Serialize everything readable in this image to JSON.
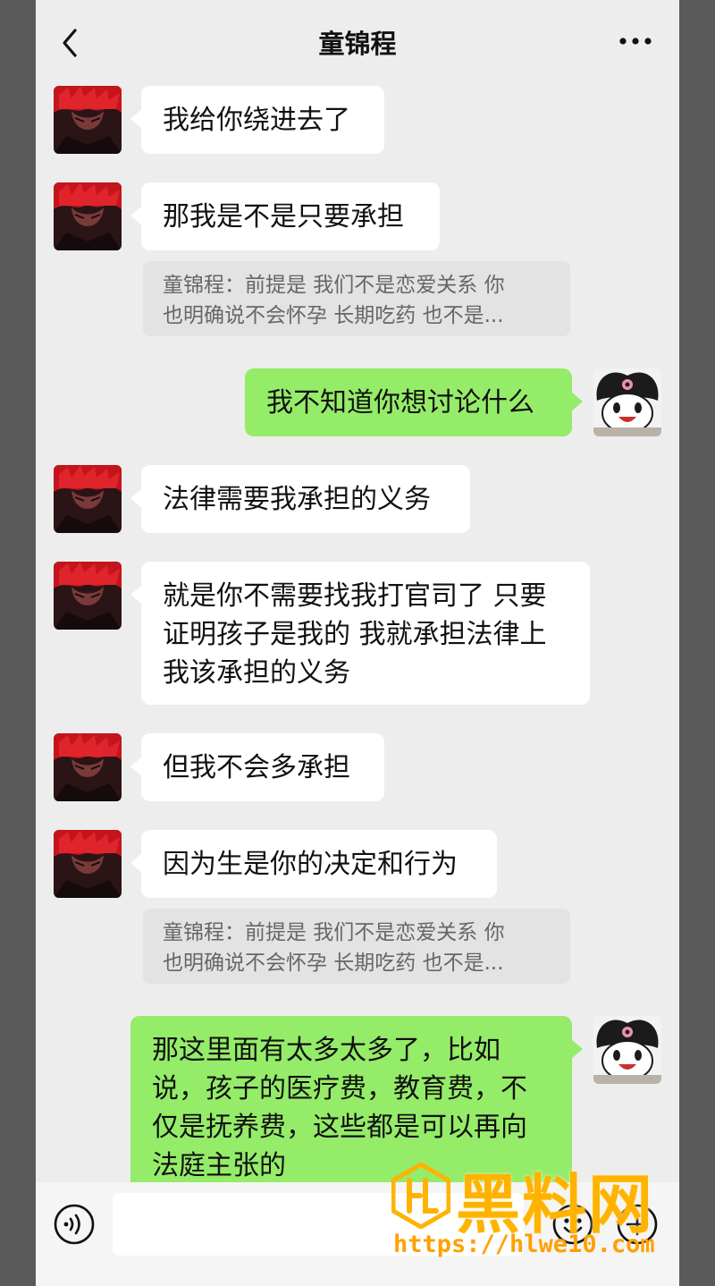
{
  "header": {
    "title": "童锦程"
  },
  "messages": [
    {
      "side": "in",
      "text": "我给你绕进去了"
    },
    {
      "side": "in",
      "text": "那我是不是只要承担"
    },
    {
      "type": "quote",
      "line1": "童锦程：前提是 我们不是恋爱关系 你",
      "line2": "也明确说不会怀孕 长期吃药 也不是..."
    },
    {
      "side": "out",
      "text": "我不知道你想讨论什么"
    },
    {
      "side": "in",
      "text": "法律需要我承担的义务"
    },
    {
      "side": "in",
      "lines": [
        "就是你不需要找我打官司了 只要",
        "证明孩子是我的 我就承担法律上",
        "我该承担的义务"
      ]
    },
    {
      "side": "in",
      "text": "但我不会多承担"
    },
    {
      "side": "in",
      "text": "因为生是你的决定和行为"
    },
    {
      "type": "quote",
      "line1": "童锦程：前提是 我们不是恋爱关系 你",
      "line2": "也明确说不会怀孕 长期吃药 也不是..."
    },
    {
      "side": "out",
      "lines": [
        "那这里面有太多太多了，比如",
        "说，孩子的医疗费，教育费，不",
        "仅是抚养费，这些都是可以再向",
        "法庭主张的"
      ]
    }
  ],
  "watermark": {
    "brand": "黑料网",
    "url": "https://hlwe10.com"
  },
  "colors": {
    "incoming_bubble": "#ffffff",
    "outgoing_bubble": "#95ec69",
    "background": "#ededed",
    "watermark": "#ffb300"
  },
  "icons": [
    "back-arrow-icon",
    "more-dots-icon",
    "voice-icon",
    "emoji-icon",
    "plus-icon",
    "contact-avatar",
    "self-avatar"
  ]
}
